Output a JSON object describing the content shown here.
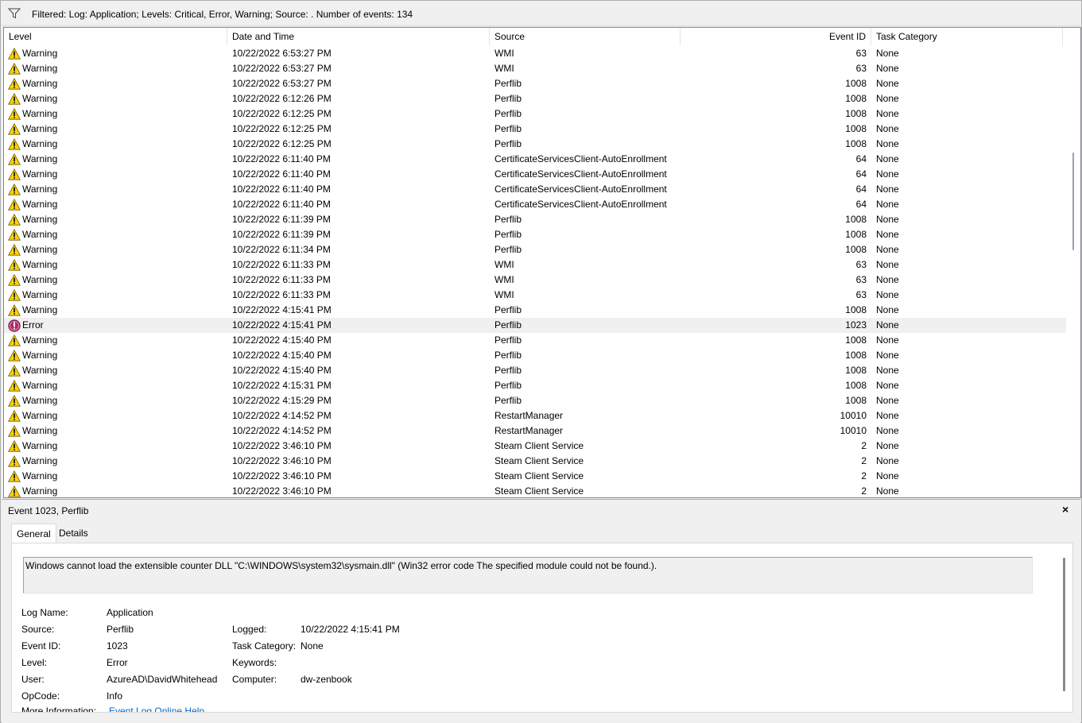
{
  "filter_bar": {
    "icon": "filter-icon",
    "text": "Filtered: Log: Application; Levels: Critical, Error, Warning; Source: . Number of events: 134"
  },
  "columns": {
    "level": "Level",
    "datetime": "Date and Time",
    "source": "Source",
    "event_id": "Event ID",
    "task_category": "Task Category"
  },
  "events": [
    {
      "level": "Warning",
      "datetime": "10/22/2022 6:53:27 PM",
      "source": "WMI",
      "event_id": "63",
      "category": "None"
    },
    {
      "level": "Warning",
      "datetime": "10/22/2022 6:53:27 PM",
      "source": "WMI",
      "event_id": "63",
      "category": "None"
    },
    {
      "level": "Warning",
      "datetime": "10/22/2022 6:53:27 PM",
      "source": "Perflib",
      "event_id": "1008",
      "category": "None"
    },
    {
      "level": "Warning",
      "datetime": "10/22/2022 6:12:26 PM",
      "source": "Perflib",
      "event_id": "1008",
      "category": "None"
    },
    {
      "level": "Warning",
      "datetime": "10/22/2022 6:12:25 PM",
      "source": "Perflib",
      "event_id": "1008",
      "category": "None"
    },
    {
      "level": "Warning",
      "datetime": "10/22/2022 6:12:25 PM",
      "source": "Perflib",
      "event_id": "1008",
      "category": "None"
    },
    {
      "level": "Warning",
      "datetime": "10/22/2022 6:12:25 PM",
      "source": "Perflib",
      "event_id": "1008",
      "category": "None"
    },
    {
      "level": "Warning",
      "datetime": "10/22/2022 6:11:40 PM",
      "source": "CertificateServicesClient-AutoEnrollment",
      "event_id": "64",
      "category": "None"
    },
    {
      "level": "Warning",
      "datetime": "10/22/2022 6:11:40 PM",
      "source": "CertificateServicesClient-AutoEnrollment",
      "event_id": "64",
      "category": "None"
    },
    {
      "level": "Warning",
      "datetime": "10/22/2022 6:11:40 PM",
      "source": "CertificateServicesClient-AutoEnrollment",
      "event_id": "64",
      "category": "None"
    },
    {
      "level": "Warning",
      "datetime": "10/22/2022 6:11:40 PM",
      "source": "CertificateServicesClient-AutoEnrollment",
      "event_id": "64",
      "category": "None"
    },
    {
      "level": "Warning",
      "datetime": "10/22/2022 6:11:39 PM",
      "source": "Perflib",
      "event_id": "1008",
      "category": "None"
    },
    {
      "level": "Warning",
      "datetime": "10/22/2022 6:11:39 PM",
      "source": "Perflib",
      "event_id": "1008",
      "category": "None"
    },
    {
      "level": "Warning",
      "datetime": "10/22/2022 6:11:34 PM",
      "source": "Perflib",
      "event_id": "1008",
      "category": "None"
    },
    {
      "level": "Warning",
      "datetime": "10/22/2022 6:11:33 PM",
      "source": "WMI",
      "event_id": "63",
      "category": "None"
    },
    {
      "level": "Warning",
      "datetime": "10/22/2022 6:11:33 PM",
      "source": "WMI",
      "event_id": "63",
      "category": "None"
    },
    {
      "level": "Warning",
      "datetime": "10/22/2022 6:11:33 PM",
      "source": "WMI",
      "event_id": "63",
      "category": "None"
    },
    {
      "level": "Warning",
      "datetime": "10/22/2022 4:15:41 PM",
      "source": "Perflib",
      "event_id": "1008",
      "category": "None"
    },
    {
      "level": "Error",
      "datetime": "10/22/2022 4:15:41 PM",
      "source": "Perflib",
      "event_id": "1023",
      "category": "None",
      "selected": true
    },
    {
      "level": "Warning",
      "datetime": "10/22/2022 4:15:40 PM",
      "source": "Perflib",
      "event_id": "1008",
      "category": "None"
    },
    {
      "level": "Warning",
      "datetime": "10/22/2022 4:15:40 PM",
      "source": "Perflib",
      "event_id": "1008",
      "category": "None"
    },
    {
      "level": "Warning",
      "datetime": "10/22/2022 4:15:40 PM",
      "source": "Perflib",
      "event_id": "1008",
      "category": "None"
    },
    {
      "level": "Warning",
      "datetime": "10/22/2022 4:15:31 PM",
      "source": "Perflib",
      "event_id": "1008",
      "category": "None"
    },
    {
      "level": "Warning",
      "datetime": "10/22/2022 4:15:29 PM",
      "source": "Perflib",
      "event_id": "1008",
      "category": "None"
    },
    {
      "level": "Warning",
      "datetime": "10/22/2022 4:14:52 PM",
      "source": "RestartManager",
      "event_id": "10010",
      "category": "None"
    },
    {
      "level": "Warning",
      "datetime": "10/22/2022 4:14:52 PM",
      "source": "RestartManager",
      "event_id": "10010",
      "category": "None"
    },
    {
      "level": "Warning",
      "datetime": "10/22/2022 3:46:10 PM",
      "source": "Steam Client Service",
      "event_id": "2",
      "category": "None"
    },
    {
      "level": "Warning",
      "datetime": "10/22/2022 3:46:10 PM",
      "source": "Steam Client Service",
      "event_id": "2",
      "category": "None"
    },
    {
      "level": "Warning",
      "datetime": "10/22/2022 3:46:10 PM",
      "source": "Steam Client Service",
      "event_id": "2",
      "category": "None"
    },
    {
      "level": "Warning",
      "datetime": "10/22/2022 3:46:10 PM",
      "source": "Steam Client Service",
      "event_id": "2",
      "category": "None"
    }
  ],
  "level_icons": {
    "Warning": "warning-icon",
    "Error": "error-icon"
  },
  "detail": {
    "title": "Event 1023, Perflib",
    "close": "×",
    "tabs": {
      "general": "General",
      "details": "Details"
    },
    "message": "Windows cannot load the extensible counter DLL \"C:\\WINDOWS\\system32\\sysmain.dll\" (Win32 error code The specified module could not be found.).",
    "labels": {
      "log_name": "Log Name:",
      "source": "Source:",
      "event_id": "Event ID:",
      "level": "Level:",
      "user": "User:",
      "opcode": "OpCode:",
      "more_info": "More Information:",
      "logged": "Logged:",
      "task_category": "Task Category:",
      "keywords": "Keywords:",
      "computer": "Computer:"
    },
    "values": {
      "log_name": "Application",
      "source": "Perflib",
      "event_id": "1023",
      "level": "Error",
      "user": "AzureAD\\DavidWhitehead",
      "opcode": "Info",
      "more_info": "Event Log Online Help",
      "logged": "10/22/2022 4:15:41 PM",
      "task_category": "None",
      "keywords": "",
      "computer": "dw-zenbook"
    }
  },
  "colors": {
    "warning": "#ffd200",
    "error": "#b4286c",
    "link": "#0066cc",
    "selection": "#f0f0f0"
  }
}
